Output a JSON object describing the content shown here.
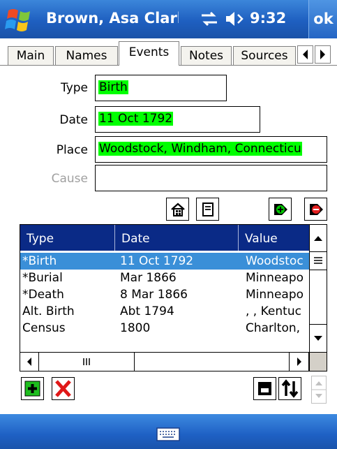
{
  "titlebar": {
    "title": "Brown, Asa Clarl",
    "time": "9:32",
    "ok_label": "ok",
    "icons": [
      "windows-flag-icon",
      "connectivity-icon",
      "speaker-icon"
    ]
  },
  "tabs": [
    {
      "label": "Main",
      "active": false
    },
    {
      "label": "Names",
      "active": false
    },
    {
      "label": "Events",
      "active": true
    },
    {
      "label": "Notes",
      "active": false
    },
    {
      "label": "Sources",
      "active": false
    }
  ],
  "form": {
    "type_label": "Type",
    "type_value": "Birth",
    "date_label": "Date",
    "date_value": "11 Oct 1792",
    "place_label": "Place",
    "place_value": "Woodstock, Windham, Connecticu",
    "cause_label": "Cause",
    "cause_value": "",
    "highlight_color": "#00ff00"
  },
  "action_icons": [
    "house-icon",
    "copy-icon",
    "add-place-icon",
    "remove-place-icon"
  ],
  "grid": {
    "headers": [
      "Type",
      "Date",
      "Value"
    ],
    "rows": [
      {
        "type": "*Birth",
        "date": "11 Oct 1792",
        "value": "Woodstoc",
        "selected": true
      },
      {
        "type": "*Burial",
        "date": "Mar 1866",
        "value": "Minneapo",
        "selected": false
      },
      {
        "type": "*Death",
        "date": "8 Mar 1866",
        "value": "Minneapo",
        "selected": false
      },
      {
        "type": "Alt. Birth",
        "date": "Abt 1794",
        "value": ", , Kentuc",
        "selected": false
      },
      {
        "type": "Census",
        "date": "1800",
        "value": "Charlton,",
        "selected": false
      }
    ],
    "header_color": "#0a2a86",
    "selected_color": "#3a8fd8"
  },
  "toolbar_icons": [
    "add-icon",
    "delete-icon",
    "save-icon",
    "sort-icon",
    "spinner-icon"
  ],
  "menubar": {
    "icons": [
      "keyboard-icon"
    ]
  }
}
